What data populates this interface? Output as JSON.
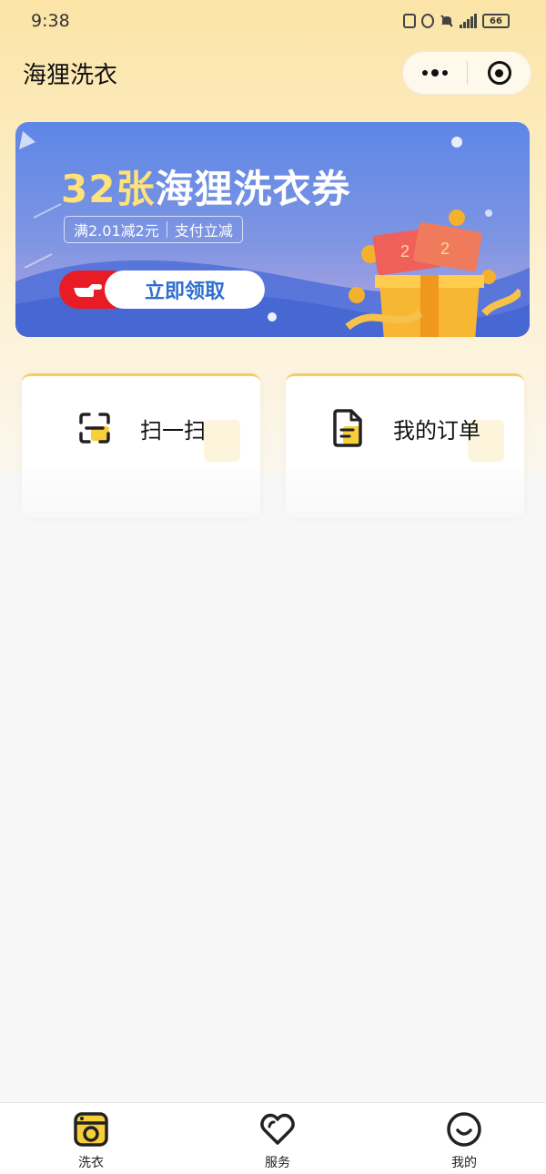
{
  "status_bar": {
    "time": "9:38",
    "battery": "66"
  },
  "nav": {
    "title": "海狸洗衣"
  },
  "banner": {
    "title_highlight": "32张",
    "title_rest": "海狸洗衣券",
    "condition": "满2.01减2元",
    "condition_note": "支付立减",
    "claim_label": "立即领取"
  },
  "actions": [
    {
      "label": "扫一扫",
      "icon": "scan-icon"
    },
    {
      "label": "我的订单",
      "icon": "order-document-icon"
    }
  ],
  "tabbar": {
    "items": [
      {
        "label": "洗衣",
        "icon": "washing-machine-icon",
        "active": true
      },
      {
        "label": "服务",
        "icon": "heart-icon",
        "active": false
      },
      {
        "label": "我的",
        "icon": "smile-face-icon",
        "active": false
      }
    ]
  },
  "colors": {
    "header_yellow": "#fbe4a6",
    "accent_yellow": "#f7cf3b",
    "banner_blue": "#5d86e6",
    "claim_red": "#e81c25",
    "claim_text": "#2f6fd0"
  }
}
